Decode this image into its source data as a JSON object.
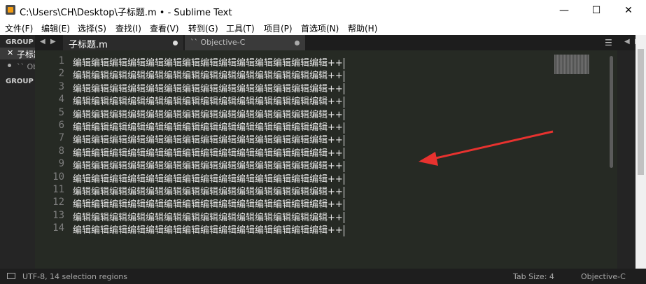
{
  "window": {
    "title": "C:\\Users\\CH\\Desktop\\子标题.m • - Sublime Text",
    "minimize": "—",
    "maximize": "☐",
    "close": "✕"
  },
  "menu": [
    "文件(F)",
    "编辑(E)",
    "选择(S)",
    "查找(I)",
    "查看(V)",
    "转到(G)",
    "工具(T)",
    "项目(P)",
    "首选项(N)",
    "帮助(H)"
  ],
  "sidebar": {
    "group1": "GROUP",
    "file1": "子标题.m",
    "file2": "`` Objective-C",
    "group2": "GROUP"
  },
  "tabs": [
    {
      "label": "子标题.m",
      "active": true
    },
    {
      "label": "`` Objective-C",
      "active": false
    }
  ],
  "editor": {
    "lines": [
      {
        "num": "1",
        "text": "编辑编辑编辑编辑编辑编辑编辑编辑编辑编辑编辑编辑编辑编辑++"
      },
      {
        "num": "2",
        "text": "编辑编辑编辑编辑编辑编辑编辑编辑编辑编辑编辑编辑编辑编辑++"
      },
      {
        "num": "3",
        "text": "编辑编辑编辑编辑编辑编辑编辑编辑编辑编辑编辑编辑编辑编辑++"
      },
      {
        "num": "4",
        "text": "编辑编辑编辑编辑编辑编辑编辑编辑编辑编辑编辑编辑编辑编辑++"
      },
      {
        "num": "5",
        "text": "编辑编辑编辑编辑编辑编辑编辑编辑编辑编辑编辑编辑编辑编辑++"
      },
      {
        "num": "6",
        "text": "编辑编辑编辑编辑编辑编辑编辑编辑编辑编辑编辑编辑编辑编辑++"
      },
      {
        "num": "7",
        "text": "编辑编辑编辑编辑编辑编辑编辑编辑编辑编辑编辑编辑编辑编辑++"
      },
      {
        "num": "8",
        "text": "编辑编辑编辑编辑编辑编辑编辑编辑编辑编辑编辑编辑编辑编辑++"
      },
      {
        "num": "9",
        "text": "编辑编辑编辑编辑编辑编辑编辑编辑编辑编辑编辑编辑编辑编辑++"
      },
      {
        "num": "10",
        "text": "编辑编辑编辑编辑编辑编辑编辑编辑编辑编辑编辑编辑编辑编辑++"
      },
      {
        "num": "11",
        "text": "编辑编辑编辑编辑编辑编辑编辑编辑编辑编辑编辑编辑编辑编辑++"
      },
      {
        "num": "12",
        "text": "编辑编辑编辑编辑编辑编辑编辑编辑编辑编辑编辑编辑编辑编辑++"
      },
      {
        "num": "13",
        "text": "编辑编辑编辑编辑编辑编辑编辑编辑编辑编辑编辑编辑编辑编辑++"
      },
      {
        "num": "14",
        "text": "编辑编辑编辑编辑编辑编辑编辑编辑编辑编辑编辑编辑编辑编辑++"
      }
    ]
  },
  "status": {
    "left": "UTF-8, 14 selection regions",
    "tab_size": "Tab Size: 4",
    "syntax": "Objective-C"
  },
  "colors": {
    "annotation_arrow": "#e8322f",
    "editor_bg": "#262a24"
  }
}
